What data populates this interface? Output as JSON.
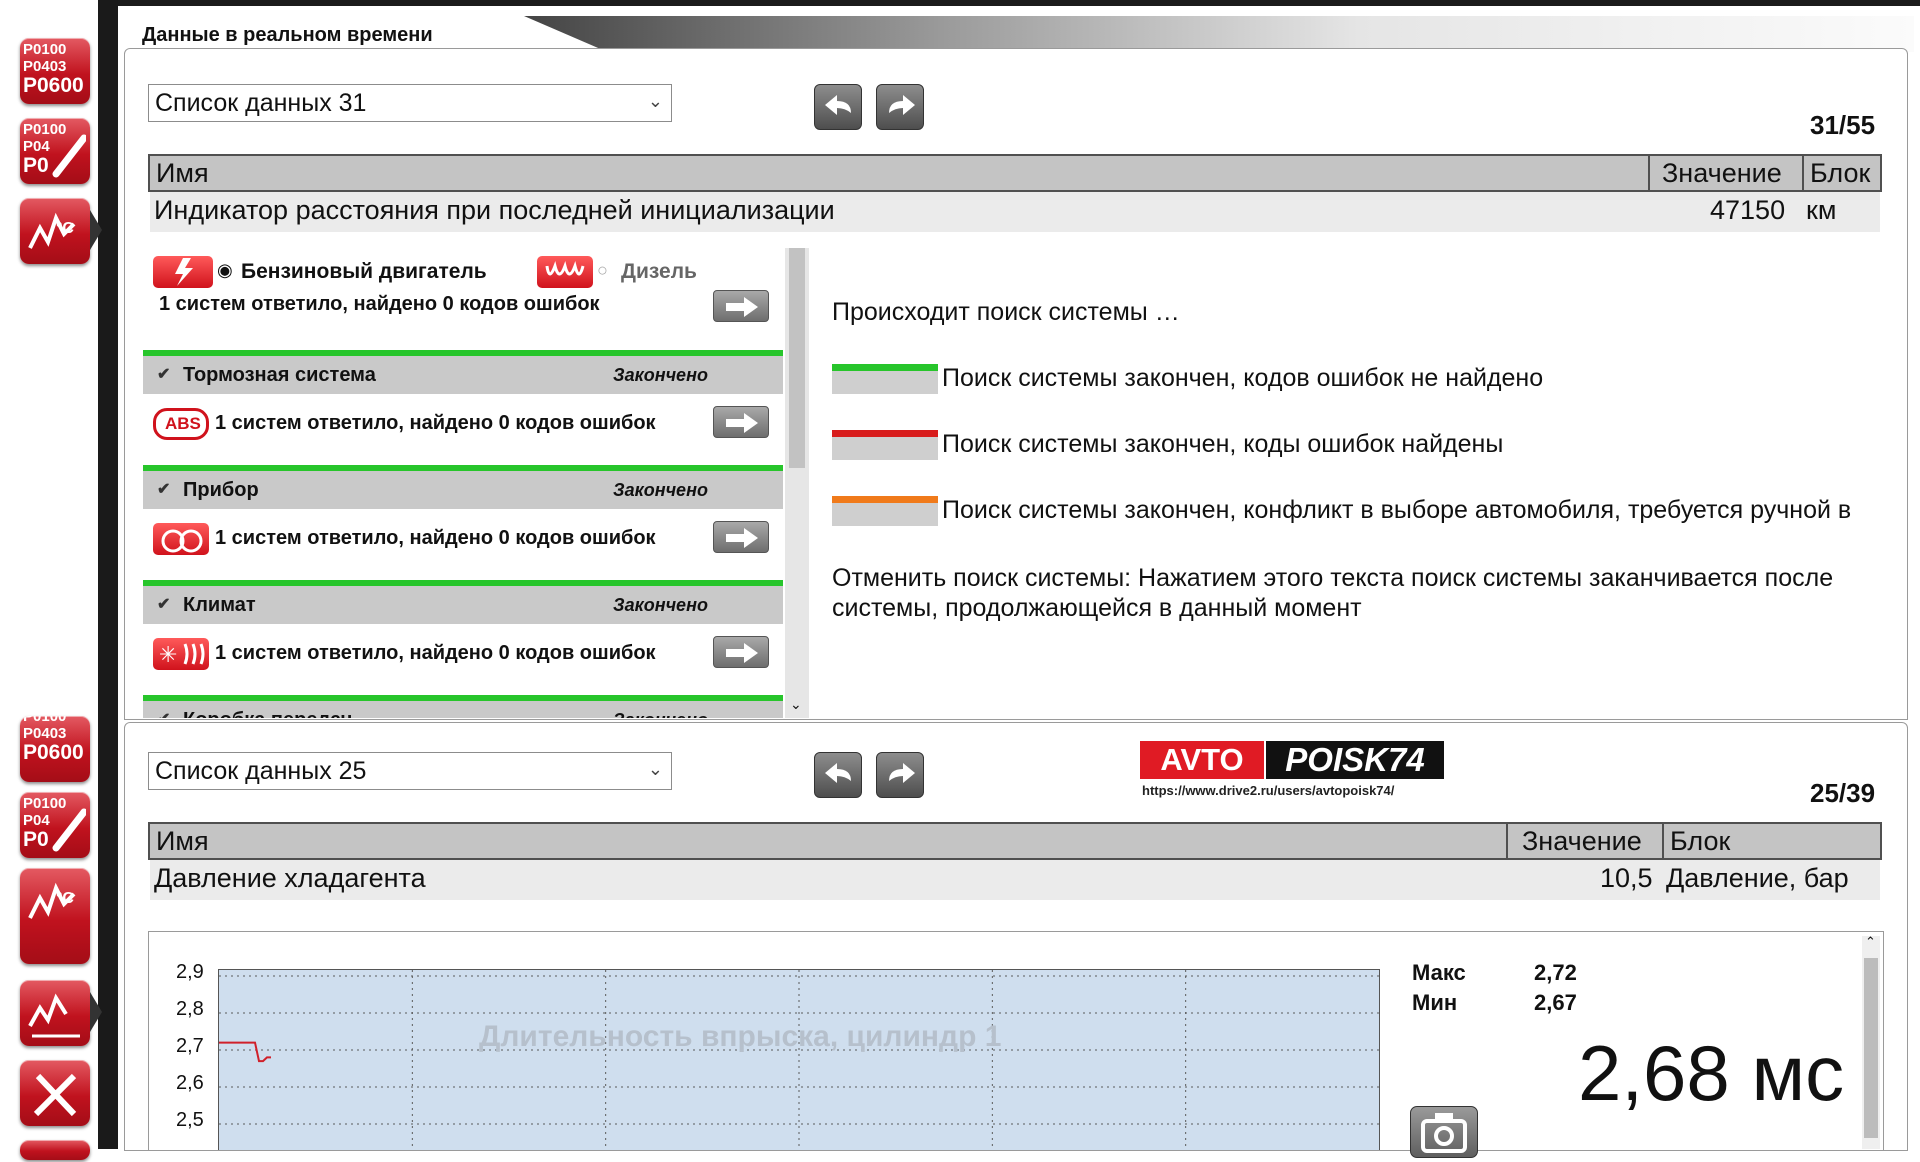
{
  "top_panel": {
    "tab_title": "Данные в реальном времени",
    "select_value": "Список данных 31",
    "counter": "31/55",
    "columns": {
      "name": "Имя",
      "value": "Значение",
      "unit": "Блок"
    },
    "row": {
      "name": "Индикатор расстояния при последней инициализации",
      "value": "47150",
      "unit": "км"
    }
  },
  "overlay": {
    "engine": {
      "petrol_label": "Бензиновый двигатель",
      "diesel_label": "Дизель",
      "result": "1 систем ответило, найдено 0 кодов ошибок"
    },
    "systems": [
      {
        "name": "Тормозная система",
        "status": "Закончено",
        "result": "1 систем ответило, найдено 0 кодов ошибок",
        "icon": "abs-icon",
        "icon_text": "ABS"
      },
      {
        "name": "Прибор",
        "status": "Закончено",
        "result": "1 систем ответило, найдено 0 кодов ошибок",
        "icon": "instrument-icon"
      },
      {
        "name": "Климат",
        "status": "Закончено",
        "result": "1 систем ответило, найдено 0 кодов ошибок",
        "icon": "climate-icon"
      },
      {
        "name": "Коробка передач",
        "status": "Закончено"
      }
    ],
    "searching": "Происходит поиск системы …",
    "legend": [
      {
        "color": "#27c52b",
        "text": "Поиск системы закончен, кодов ошибок не найдено"
      },
      {
        "color": "#d81c1c",
        "text": "Поиск системы закончен, коды ошибок найдены"
      },
      {
        "color": "#f07a1a",
        "text": "Поиск системы закончен, конфликт в выборе автомобиля, требуется ручной в"
      }
    ],
    "cancel_line1": "Отменить поиск системы: Нажатием этого текста поиск системы заканчивается после",
    "cancel_line2": "системы, продолжающейся в данный момент"
  },
  "bottom_panel": {
    "select_value": "Список данных 25",
    "counter": "25/39",
    "columns": {
      "name": "Имя",
      "value": "Значение",
      "unit": "Блок"
    },
    "row": {
      "name": "Давление хладагента",
      "value": "10,5",
      "unit": "Давление, бар"
    }
  },
  "logo": {
    "part1": "AVTO",
    "part2": "POISK74",
    "url": "https://www.drive2.ru/users/avtopoisk74/"
  },
  "graph": {
    "watermark_title": "Длительность впрыска, цилиндр 1",
    "max_label": "Макс",
    "max_value": "2,72",
    "min_label": "Мин",
    "min_value": "2,67",
    "current_value": "2,68 мс"
  },
  "sidebar_tools": [
    {
      "codes": [
        "P0100",
        "P0403",
        "P0600"
      ]
    },
    {
      "codes": [
        "P0100",
        "P04",
        "P0"
      ]
    },
    {
      "label": "°C"
    }
  ],
  "chart_data": {
    "type": "line",
    "title": "Длительность впрыска, цилиндр 1",
    "ylim": [
      2.5,
      2.9
    ],
    "y_ticks": [
      "2,9",
      "2,8",
      "2,7",
      "2,6",
      "2,5"
    ],
    "grid": true,
    "series": [
      {
        "color": "#d0202a",
        "values": [
          2.72,
          2.72,
          2.72,
          2.72,
          2.72,
          2.72,
          2.72,
          2.72,
          2.72,
          2.72,
          2.67,
          2.67,
          2.68,
          2.68
        ]
      }
    ]
  }
}
